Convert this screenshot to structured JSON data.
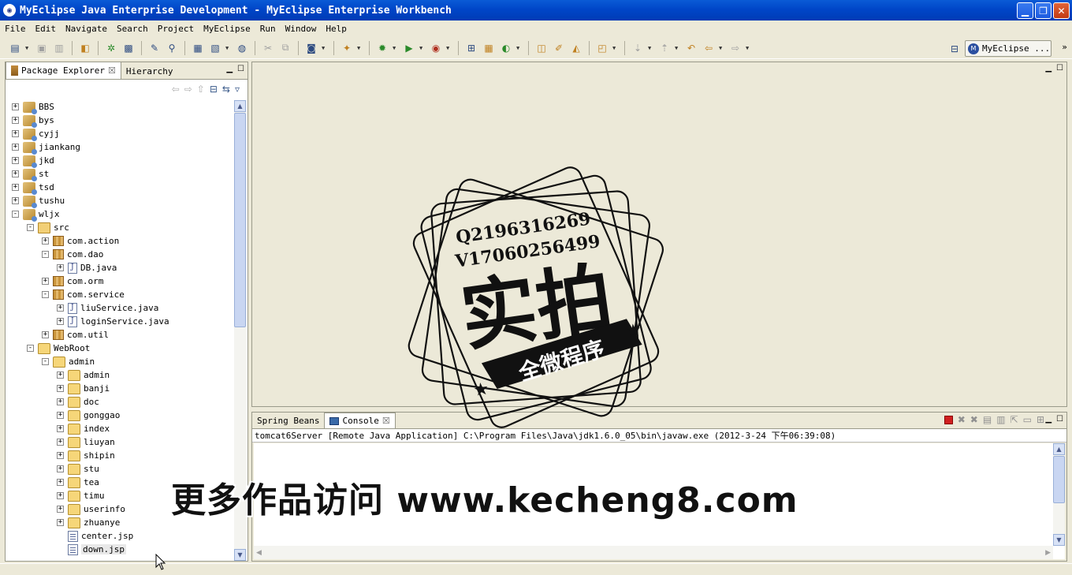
{
  "window": {
    "title": "MyEclipse Java Enterprise Development - MyEclipse Enterprise Workbench"
  },
  "menu": [
    "File",
    "Edit",
    "Navigate",
    "Search",
    "Project",
    "MyEclipse",
    "Run",
    "Window",
    "Help"
  ],
  "perspective": {
    "label": "MyEclipse ..."
  },
  "package_explorer": {
    "tabs": [
      {
        "label": "Package Explorer",
        "active": true
      },
      {
        "label": "Hierarchy",
        "active": false
      }
    ],
    "tree": [
      {
        "label": "BBS",
        "icon": "project-icon",
        "depth": 0,
        "expander": "+"
      },
      {
        "label": "bys",
        "icon": "project-icon",
        "depth": 0,
        "expander": "+"
      },
      {
        "label": "cyjj",
        "icon": "project-icon",
        "depth": 0,
        "expander": "+"
      },
      {
        "label": "jiankang",
        "icon": "project-icon",
        "depth": 0,
        "expander": "+"
      },
      {
        "label": "jkd",
        "icon": "project-icon",
        "depth": 0,
        "expander": "+"
      },
      {
        "label": "st",
        "icon": "project-icon",
        "depth": 0,
        "expander": "+"
      },
      {
        "label": "tsd",
        "icon": "project-icon",
        "depth": 0,
        "expander": "+"
      },
      {
        "label": "tushu",
        "icon": "project-icon",
        "depth": 0,
        "expander": "+"
      },
      {
        "label": "wljx",
        "icon": "project-icon",
        "depth": 0,
        "expander": "-"
      },
      {
        "label": "src",
        "icon": "source-folder-icon",
        "depth": 1,
        "expander": "-"
      },
      {
        "label": "com.action",
        "icon": "package-icon",
        "depth": 2,
        "expander": "+"
      },
      {
        "label": "com.dao",
        "icon": "package-icon",
        "depth": 2,
        "expander": "-"
      },
      {
        "label": "DB.java",
        "icon": "java-file-icon",
        "depth": 3,
        "expander": "+"
      },
      {
        "label": "com.orm",
        "icon": "package-icon",
        "depth": 2,
        "expander": "+"
      },
      {
        "label": "com.service",
        "icon": "package-icon",
        "depth": 2,
        "expander": "-"
      },
      {
        "label": "liuService.java",
        "icon": "java-file-icon",
        "depth": 3,
        "expander": "+"
      },
      {
        "label": "loginService.java",
        "icon": "java-file-icon",
        "depth": 3,
        "expander": "+"
      },
      {
        "label": "com.util",
        "icon": "package-icon",
        "depth": 2,
        "expander": "+"
      },
      {
        "label": "WebRoot",
        "icon": "folder-icon",
        "depth": 1,
        "expander": "-"
      },
      {
        "label": "admin",
        "icon": "folder-icon",
        "depth": 2,
        "expander": "-"
      },
      {
        "label": "admin",
        "icon": "folder-icon",
        "depth": 3,
        "expander": "+"
      },
      {
        "label": "banji",
        "icon": "folder-icon",
        "depth": 3,
        "expander": "+"
      },
      {
        "label": "doc",
        "icon": "folder-icon",
        "depth": 3,
        "expander": "+"
      },
      {
        "label": "gonggao",
        "icon": "folder-icon",
        "depth": 3,
        "expander": "+"
      },
      {
        "label": "index",
        "icon": "folder-icon",
        "depth": 3,
        "expander": "+"
      },
      {
        "label": "liuyan",
        "icon": "folder-icon",
        "depth": 3,
        "expander": "+"
      },
      {
        "label": "shipin",
        "icon": "folder-icon",
        "depth": 3,
        "expander": "+"
      },
      {
        "label": "stu",
        "icon": "folder-icon",
        "depth": 3,
        "expander": "+"
      },
      {
        "label": "tea",
        "icon": "folder-icon",
        "depth": 3,
        "expander": "+"
      },
      {
        "label": "timu",
        "icon": "folder-icon",
        "depth": 3,
        "expander": "+"
      },
      {
        "label": "userinfo",
        "icon": "folder-icon",
        "depth": 3,
        "expander": "+"
      },
      {
        "label": "zhuanye",
        "icon": "folder-icon",
        "depth": 3,
        "expander": "+"
      },
      {
        "label": "center.jsp",
        "icon": "jsp-file-icon",
        "depth": 3,
        "expander": ""
      },
      {
        "label": "down.jsp",
        "icon": "jsp-file-icon",
        "depth": 3,
        "expander": "",
        "selected": true
      }
    ]
  },
  "console": {
    "tabs": [
      {
        "label": "Spring Beans",
        "active": false
      },
      {
        "label": "Console",
        "active": true
      }
    ],
    "header": "tomcat6Server [Remote Java Application] C:\\Program Files\\Java\\jdk1.6.0_05\\bin\\javaw.exe (2012-3-24 下午06:39:08)"
  },
  "watermark": {
    "stamp_line1": "Q2196316269",
    "stamp_line2": "V17060256499",
    "stamp_big": "实拍",
    "stamp_ribbon": "全微程序",
    "banner": "更多作品访问 www.kecheng8.com"
  },
  "colors": {
    "titlebar": "#0046c8",
    "chrome": "#ece9d8",
    "stop": "#d02020"
  }
}
